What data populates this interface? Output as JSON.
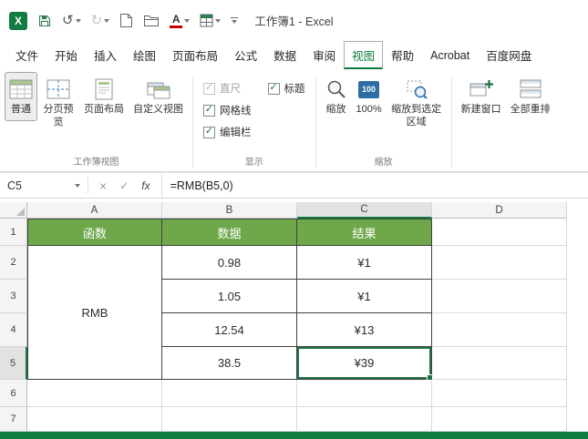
{
  "colors": {
    "table_header_green": "#6EA84B",
    "excel_green": "#107C41",
    "selection_green": "#1E7145",
    "zoom_icon_blue": "#2E6DA4",
    "font_color_red": "#C00000"
  },
  "icons": {
    "check": "✓",
    "undo": "↺",
    "redo": "↻",
    "font_color_letter": "A",
    "logo_letter": "X"
  },
  "titlebar": {
    "title": "工作簿1 - Excel"
  },
  "tabs": [
    "文件",
    "开始",
    "插入",
    "绘图",
    "页面布局",
    "公式",
    "数据",
    "审阅",
    "视图",
    "帮助",
    "Acrobat",
    "百度网盘"
  ],
  "ribbon": {
    "workbook_views": {
      "group_label": "工作簿视图",
      "normal": "普通",
      "page_break_preview": "分页预览",
      "page_layout": "页面布局",
      "custom_views": "自定义视图"
    },
    "show": {
      "group_label": "显示",
      "ruler": "直尺",
      "headings": "标题",
      "gridlines": "网格线",
      "formula_bar": "编辑栏"
    },
    "zoom": {
      "group_label": "缩放",
      "zoom": "缩放",
      "pct_icon": "100",
      "pct": "100%",
      "to_selection": "缩放到选定区域"
    },
    "window": {
      "new_window": "新建窗口",
      "arrange_all": "全部重排"
    }
  },
  "formula_bar": {
    "name_box": "C5",
    "cancel": "×",
    "enter": "✓",
    "fx": "fx",
    "formula": "=RMB(B5,0)"
  },
  "sheet": {
    "columns": [
      "A",
      "B",
      "C",
      "D"
    ],
    "rows": [
      "1",
      "2",
      "3",
      "4",
      "5",
      "6",
      "7"
    ],
    "selected_cell": "C5",
    "table": {
      "header_function": "函数",
      "header_data": "数据",
      "header_result": "结果",
      "function_name": "RMB",
      "values": [
        {
          "data": "0.98",
          "result": "¥1"
        },
        {
          "data": "1.05",
          "result": "¥1"
        },
        {
          "data": "12.54",
          "result": "¥13"
        },
        {
          "data": "38.5",
          "result": "¥39"
        }
      ]
    }
  }
}
